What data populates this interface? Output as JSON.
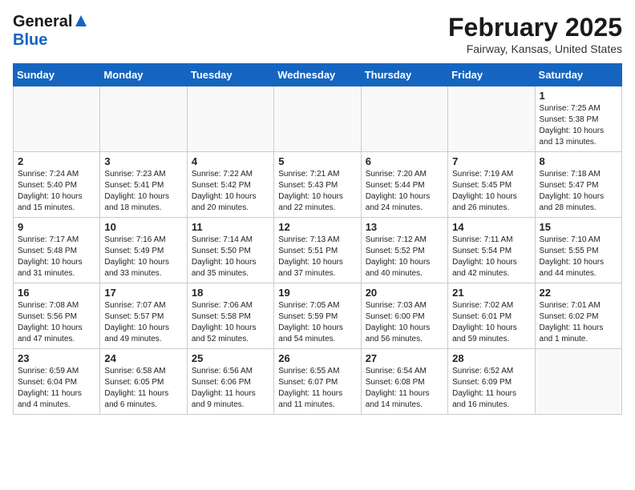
{
  "header": {
    "logo_line1": "General",
    "logo_line2": "Blue",
    "title": "February 2025",
    "subtitle": "Fairway, Kansas, United States"
  },
  "calendar": {
    "days_of_week": [
      "Sunday",
      "Monday",
      "Tuesday",
      "Wednesday",
      "Thursday",
      "Friday",
      "Saturday"
    ],
    "weeks": [
      [
        {
          "day": "",
          "empty": true
        },
        {
          "day": "",
          "empty": true
        },
        {
          "day": "",
          "empty": true
        },
        {
          "day": "",
          "empty": true
        },
        {
          "day": "",
          "empty": true
        },
        {
          "day": "",
          "empty": true
        },
        {
          "day": "1",
          "sunrise": "7:25 AM",
          "sunset": "5:38 PM",
          "daylight": "Daylight: 10 hours and 13 minutes."
        }
      ],
      [
        {
          "day": "2",
          "sunrise": "7:24 AM",
          "sunset": "5:40 PM",
          "daylight": "Daylight: 10 hours and 15 minutes."
        },
        {
          "day": "3",
          "sunrise": "7:23 AM",
          "sunset": "5:41 PM",
          "daylight": "Daylight: 10 hours and 18 minutes."
        },
        {
          "day": "4",
          "sunrise": "7:22 AM",
          "sunset": "5:42 PM",
          "daylight": "Daylight: 10 hours and 20 minutes."
        },
        {
          "day": "5",
          "sunrise": "7:21 AM",
          "sunset": "5:43 PM",
          "daylight": "Daylight: 10 hours and 22 minutes."
        },
        {
          "day": "6",
          "sunrise": "7:20 AM",
          "sunset": "5:44 PM",
          "daylight": "Daylight: 10 hours and 24 minutes."
        },
        {
          "day": "7",
          "sunrise": "7:19 AM",
          "sunset": "5:45 PM",
          "daylight": "Daylight: 10 hours and 26 minutes."
        },
        {
          "day": "8",
          "sunrise": "7:18 AM",
          "sunset": "5:47 PM",
          "daylight": "Daylight: 10 hours and 28 minutes."
        }
      ],
      [
        {
          "day": "9",
          "sunrise": "7:17 AM",
          "sunset": "5:48 PM",
          "daylight": "Daylight: 10 hours and 31 minutes."
        },
        {
          "day": "10",
          "sunrise": "7:16 AM",
          "sunset": "5:49 PM",
          "daylight": "Daylight: 10 hours and 33 minutes."
        },
        {
          "day": "11",
          "sunrise": "7:14 AM",
          "sunset": "5:50 PM",
          "daylight": "Daylight: 10 hours and 35 minutes."
        },
        {
          "day": "12",
          "sunrise": "7:13 AM",
          "sunset": "5:51 PM",
          "daylight": "Daylight: 10 hours and 37 minutes."
        },
        {
          "day": "13",
          "sunrise": "7:12 AM",
          "sunset": "5:52 PM",
          "daylight": "Daylight: 10 hours and 40 minutes."
        },
        {
          "day": "14",
          "sunrise": "7:11 AM",
          "sunset": "5:54 PM",
          "daylight": "Daylight: 10 hours and 42 minutes."
        },
        {
          "day": "15",
          "sunrise": "7:10 AM",
          "sunset": "5:55 PM",
          "daylight": "Daylight: 10 hours and 44 minutes."
        }
      ],
      [
        {
          "day": "16",
          "sunrise": "7:08 AM",
          "sunset": "5:56 PM",
          "daylight": "Daylight: 10 hours and 47 minutes."
        },
        {
          "day": "17",
          "sunrise": "7:07 AM",
          "sunset": "5:57 PM",
          "daylight": "Daylight: 10 hours and 49 minutes."
        },
        {
          "day": "18",
          "sunrise": "7:06 AM",
          "sunset": "5:58 PM",
          "daylight": "Daylight: 10 hours and 52 minutes."
        },
        {
          "day": "19",
          "sunrise": "7:05 AM",
          "sunset": "5:59 PM",
          "daylight": "Daylight: 10 hours and 54 minutes."
        },
        {
          "day": "20",
          "sunrise": "7:03 AM",
          "sunset": "6:00 PM",
          "daylight": "Daylight: 10 hours and 56 minutes."
        },
        {
          "day": "21",
          "sunrise": "7:02 AM",
          "sunset": "6:01 PM",
          "daylight": "Daylight: 10 hours and 59 minutes."
        },
        {
          "day": "22",
          "sunrise": "7:01 AM",
          "sunset": "6:02 PM",
          "daylight": "Daylight: 11 hours and 1 minute."
        }
      ],
      [
        {
          "day": "23",
          "sunrise": "6:59 AM",
          "sunset": "6:04 PM",
          "daylight": "Daylight: 11 hours and 4 minutes."
        },
        {
          "day": "24",
          "sunrise": "6:58 AM",
          "sunset": "6:05 PM",
          "daylight": "Daylight: 11 hours and 6 minutes."
        },
        {
          "day": "25",
          "sunrise": "6:56 AM",
          "sunset": "6:06 PM",
          "daylight": "Daylight: 11 hours and 9 minutes."
        },
        {
          "day": "26",
          "sunrise": "6:55 AM",
          "sunset": "6:07 PM",
          "daylight": "Daylight: 11 hours and 11 minutes."
        },
        {
          "day": "27",
          "sunrise": "6:54 AM",
          "sunset": "6:08 PM",
          "daylight": "Daylight: 11 hours and 14 minutes."
        },
        {
          "day": "28",
          "sunrise": "6:52 AM",
          "sunset": "6:09 PM",
          "daylight": "Daylight: 11 hours and 16 minutes."
        },
        {
          "day": "",
          "empty": true
        }
      ]
    ]
  }
}
